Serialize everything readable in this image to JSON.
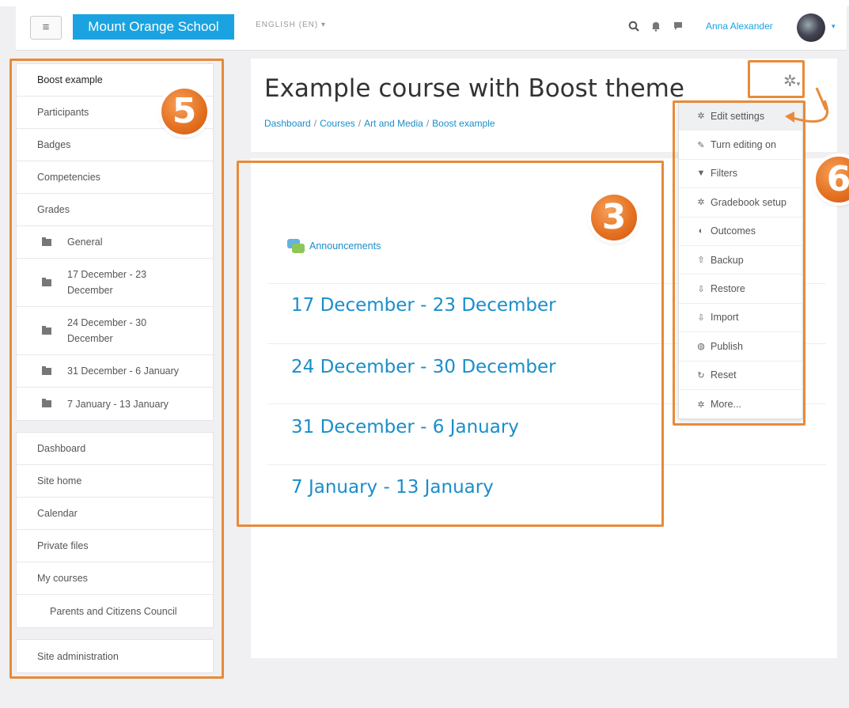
{
  "navbar": {
    "menu_icon": "hamburger-icon",
    "brand": "Mount Orange School",
    "language": "ENGLISH (EN) ▾",
    "icons": [
      "search-icon",
      "bell-icon",
      "chat-icon"
    ],
    "user_name": "Anna Alexander",
    "user_caret": "▾"
  },
  "sidebar": {
    "course_nav": [
      {
        "label": "Boost example"
      },
      {
        "label": "Participants"
      },
      {
        "label": "Badges"
      },
      {
        "label": "Competencies"
      },
      {
        "label": "Grades"
      }
    ],
    "sections": [
      {
        "label": "General"
      },
      {
        "label": "17 December - 23 December"
      },
      {
        "label": "24 December - 30 December"
      },
      {
        "label": "31 December - 6 January"
      },
      {
        "label": "7 January - 13 January"
      }
    ],
    "site_nav": [
      {
        "label": "Dashboard"
      },
      {
        "label": "Site home"
      },
      {
        "label": "Calendar"
      },
      {
        "label": "Private files"
      },
      {
        "label": "My courses"
      },
      {
        "label": "Parents and Citizens Council"
      }
    ],
    "admin": {
      "label": "Site administration"
    }
  },
  "header": {
    "title": "Example course with Boost theme",
    "breadcrumb": [
      "Dashboard",
      "Courses",
      "Art and Media",
      "Boost example"
    ],
    "breadcrumb_sep": "/"
  },
  "content": {
    "announcements": "Announcements",
    "sections": [
      "17 December - 23 December",
      "24 December - 30 December",
      "31 December - 6 January",
      "7 January - 13 January"
    ]
  },
  "action_menu": {
    "items": [
      {
        "label": "Edit settings",
        "icon": "gear-icon",
        "glyph": "✲"
      },
      {
        "label": "Turn editing on",
        "icon": "pencil-icon",
        "glyph": "✎"
      },
      {
        "label": "Filters",
        "icon": "filter-icon",
        "glyph": "▼"
      },
      {
        "label": "Gradebook setup",
        "icon": "gear-icon",
        "glyph": "✲"
      },
      {
        "label": "Outcomes",
        "icon": "outcomes-icon",
        "glyph": "◐"
      },
      {
        "label": "Backup",
        "icon": "upload-icon",
        "glyph": "⇧"
      },
      {
        "label": "Restore",
        "icon": "download-icon",
        "glyph": "⇩"
      },
      {
        "label": "Import",
        "icon": "import-icon",
        "glyph": "⇩"
      },
      {
        "label": "Publish",
        "icon": "globe-icon",
        "glyph": "◍"
      },
      {
        "label": "Reset",
        "icon": "reset-icon",
        "glyph": "↻"
      },
      {
        "label": "More...",
        "icon": "gear-icon",
        "glyph": "✲"
      }
    ]
  },
  "callouts": {
    "sidebar": "5",
    "content": "3",
    "menu": "6"
  },
  "colors": {
    "brand": "#1aa3e0",
    "link": "#1a8ec9",
    "callout": "#e88a3a"
  }
}
